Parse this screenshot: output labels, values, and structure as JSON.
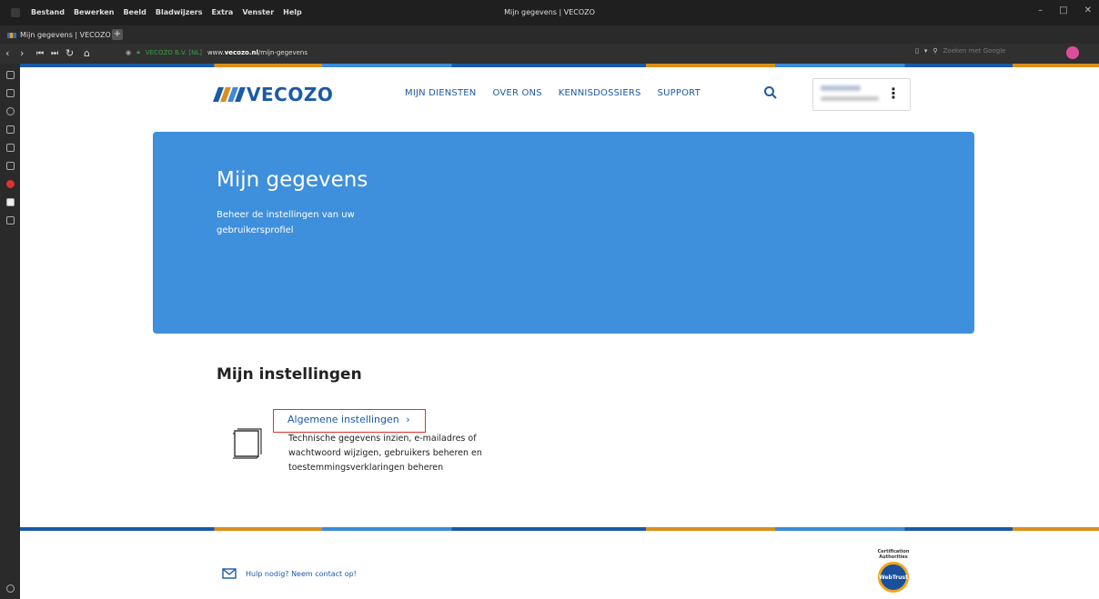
{
  "browser": {
    "menu": [
      "Bestand",
      "Bewerken",
      "Beeld",
      "Bladwijzers",
      "Extra",
      "Venster",
      "Help"
    ],
    "window_title": "Mijn gegevens | VECOZO",
    "tab_title": "Mijn gegevens | VECOZO",
    "cert_label": "VECOZO B.V. [NL]",
    "url_prefix": "www.",
    "url_domain": "vecozo.nl",
    "url_path": "/mijn-gegevens",
    "search_placeholder": "Zoeken met Google"
  },
  "site": {
    "logo_text": "VECOZO",
    "logo_bar_colors": [
      "#1a5aa6",
      "#d98f1c",
      "#3b8bd8",
      "#1a5aa6"
    ],
    "nav": [
      "MIJN DIENSTEN",
      "OVER ONS",
      "KENNISDOSSIERS",
      "SUPPORT"
    ]
  },
  "hero": {
    "title": "Mijn gegevens",
    "subtitle": "Beheer de instellingen van uw gebruikersprofiel"
  },
  "settings": {
    "section_title": "Mijn instellingen",
    "link_label": "Algemene instellingen",
    "link_chevron": "›",
    "description": "Technische gegevens inzien, e-mailadres of wachtwoord wijzigen, gebruikers beheren en toestemmingsverklaringen beheren"
  },
  "footer": {
    "help_text": "Hulp nodig? Neem contact op!",
    "badge_title": "Certification Authorities",
    "badge_name": "WebTrust"
  },
  "colors": {
    "brand_blue": "#1a5aa6",
    "hero_blue": "#3e8fdc",
    "accent_orange": "#d98f1c",
    "highlight_red": "#e0302b"
  }
}
